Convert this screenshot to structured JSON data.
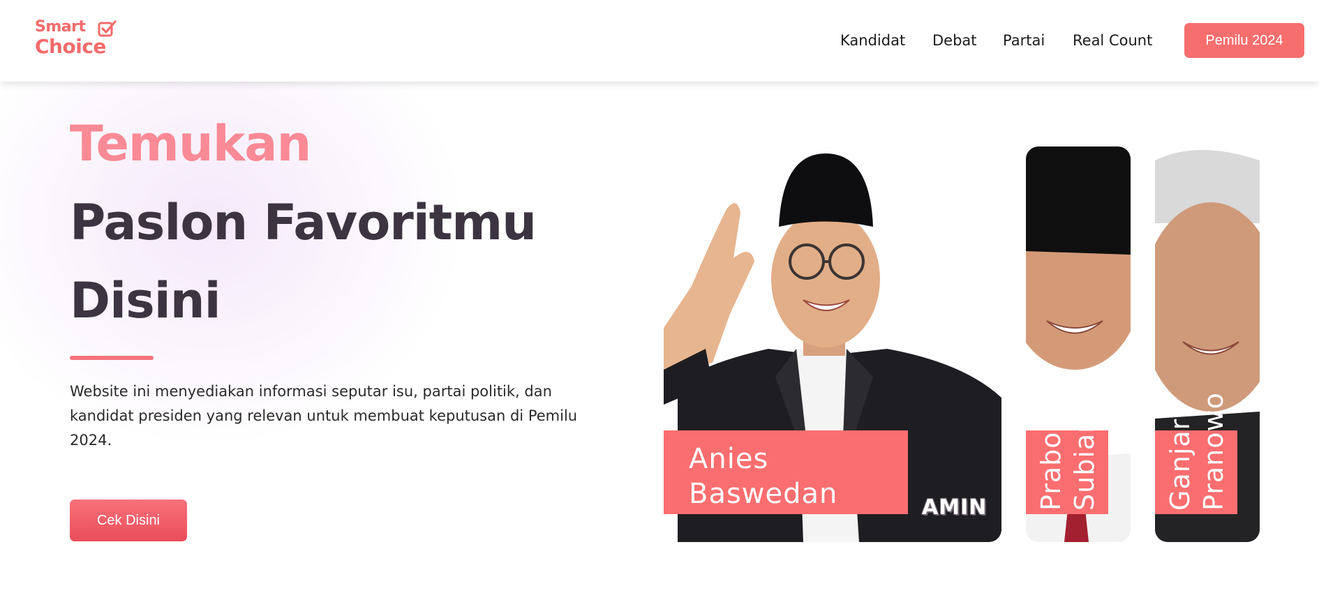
{
  "brand": {
    "line1": "Smart",
    "line2": "Choice",
    "color": "#f46b6b"
  },
  "nav": {
    "items": [
      "Kandidat",
      "Debat",
      "Partai",
      "Real Count"
    ],
    "cta": "Pemilu 2024"
  },
  "hero": {
    "title_line1": "Temukan",
    "title_line2": "Paslon Favoritmu",
    "title_line3": "Disini",
    "description": "Website ini menyediakan informasi seputar isu, partai politik, dan kandidat presiden yang relevan untuk membuat keputusan di Pemilu 2024.",
    "button": "Cek Disini",
    "accent": "#f98a96"
  },
  "candidates": [
    {
      "first": "Anies",
      "last": "Baswedan",
      "badge": "AMIN"
    },
    {
      "first": "Prabowo",
      "last": "Subianto"
    },
    {
      "first": "Ganjar",
      "last": "Pranowo"
    }
  ]
}
